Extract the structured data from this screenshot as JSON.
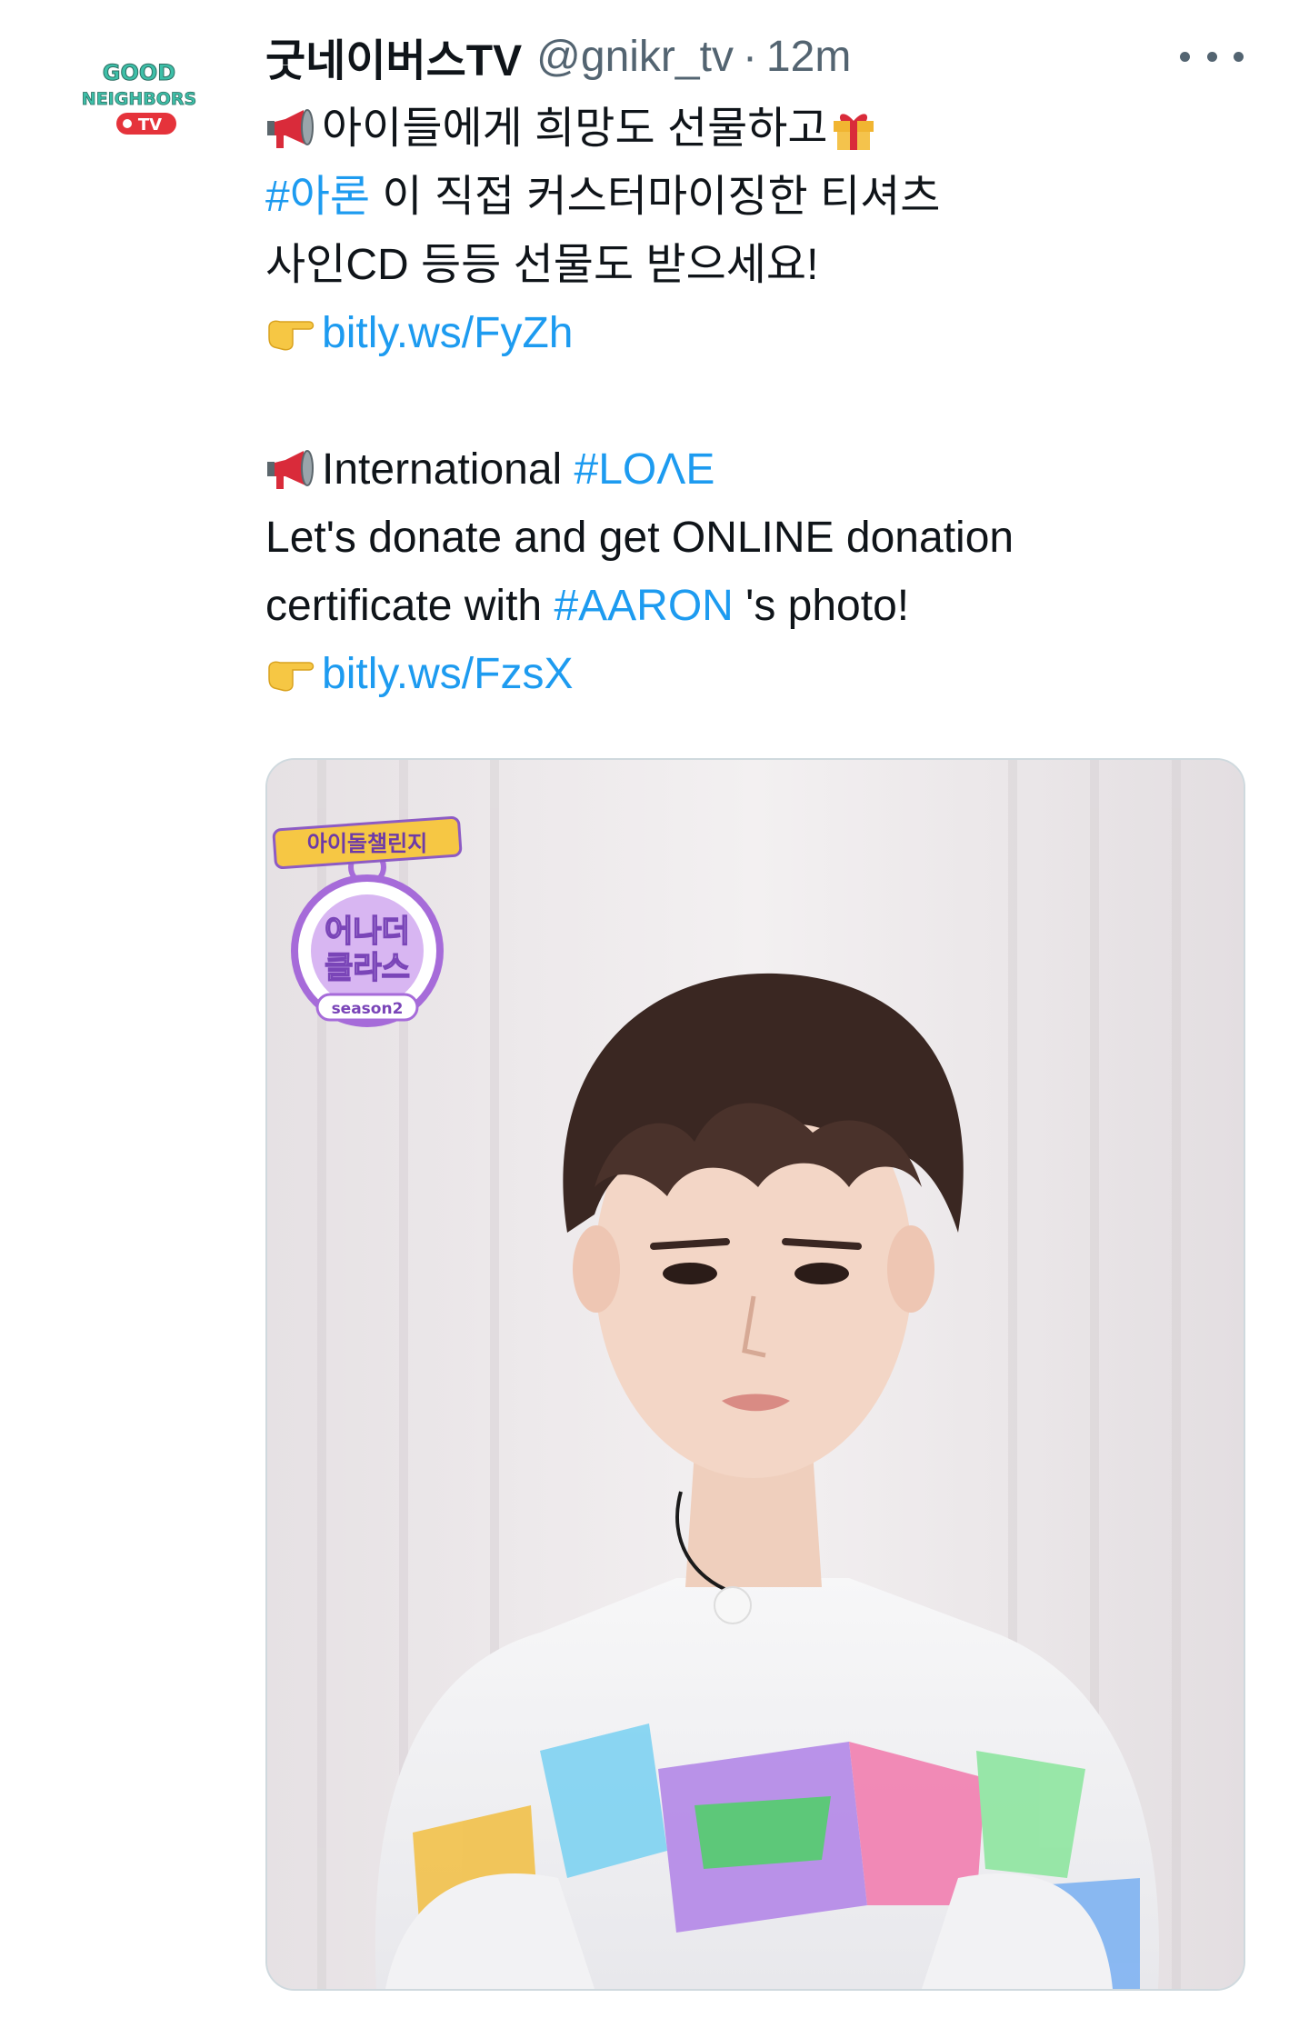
{
  "tweet": {
    "author": {
      "display_name": "굿네이버스TV",
      "handle": "@gnikr_tv",
      "separator": "·",
      "time": "12m",
      "avatar": {
        "logo_line1": "GOOD",
        "logo_line2": "NEIGHBORS",
        "logo_tv": "TV",
        "brand_color": "#3dbfa8",
        "tv_color": "#e5333b"
      }
    },
    "more_icon": "more-horizontal-icon",
    "body": {
      "korean": {
        "line1_text": "아이들에게 희망도 선물하고",
        "line2_hashtag": "#아론",
        "line2_text": " 이 직접 커스터마이징한 티셔츠",
        "line3_text": "사인CD 등등 선물도 받으세요!",
        "line4_link": "bitly.ws/FyZh"
      },
      "english": {
        "line1_text": "International ",
        "line1_hashtag": "#LOΛE",
        "line2_text": "Let's donate and get ONLINE donation",
        "line3_text": "certificate with ",
        "line3_hashtag": "#AARON",
        "line3_tail": " 's photo!",
        "line4_link": "bitly.ws/FzsX"
      }
    },
    "emojis": {
      "megaphone": "megaphone-icon",
      "gift": "gift-icon",
      "pointing_hand": "pointing-right-icon"
    },
    "media": {
      "badge": {
        "top_label": "아이돌챌린지",
        "title_line1": "어나더",
        "title_line2": "클라스",
        "season": "season2",
        "badge_color": "#a66bd9",
        "ribbon_color": "#f6c744"
      }
    },
    "colors": {
      "link": "#1d9bf0",
      "text": "#0f1419",
      "muted": "#536471",
      "border": "#cfd9de"
    }
  }
}
